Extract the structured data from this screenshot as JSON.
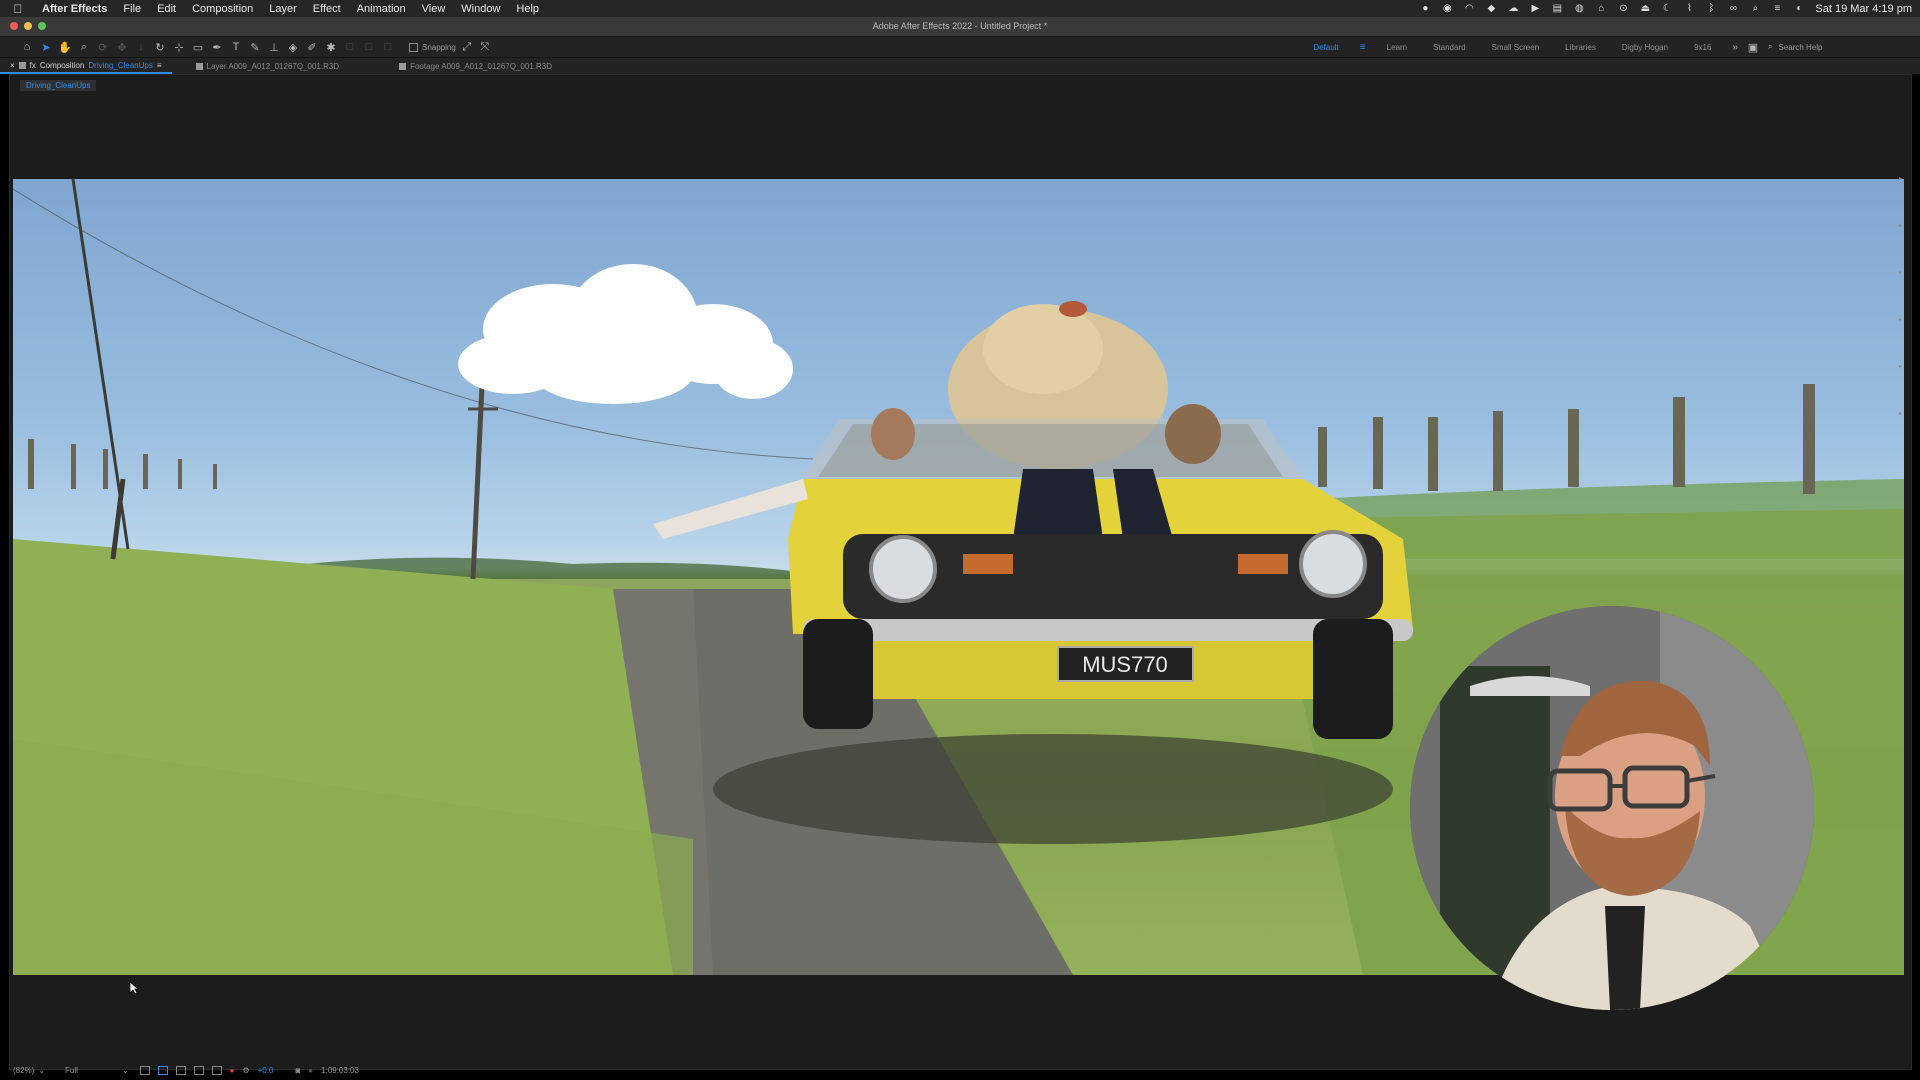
{
  "menubar": {
    "app_name": "After Effects",
    "items": [
      "File",
      "Edit",
      "Composition",
      "Layer",
      "Effect",
      "Animation",
      "View",
      "Window",
      "Help"
    ],
    "clock": "Sat 19 Mar  4:19 pm"
  },
  "window": {
    "title": "Adobe After Effects 2022 - Untitled Project *"
  },
  "toolbar": {
    "snapping_label": "Snapping",
    "workspaces": [
      "Default",
      "Learn",
      "Standard",
      "Small Screen",
      "Libraries",
      "Digby Hogan",
      "9x16"
    ],
    "active_workspace": "Default",
    "more_label": "»",
    "search_placeholder": "Search Help"
  },
  "panels": {
    "composition_tab": {
      "prefix": "Composition",
      "name": "Driving_CleanUps"
    },
    "layer_tab": "Layer A009_A012_01267Q_001.R3D",
    "footage_tab": "Footage A009_A012_01267Q_001.R3D"
  },
  "viewer": {
    "breadcrumb": "Driving_CleanUps",
    "plate_text": "MUS770",
    "zoom": "(82%)",
    "resolution": "Full",
    "exposure": "+0.0",
    "timecode": "1:09:03:03"
  },
  "colors": {
    "accent": "#2d8ceb",
    "panel_bg": "#1c1c1c",
    "car_yellow": "#e3d23a"
  }
}
